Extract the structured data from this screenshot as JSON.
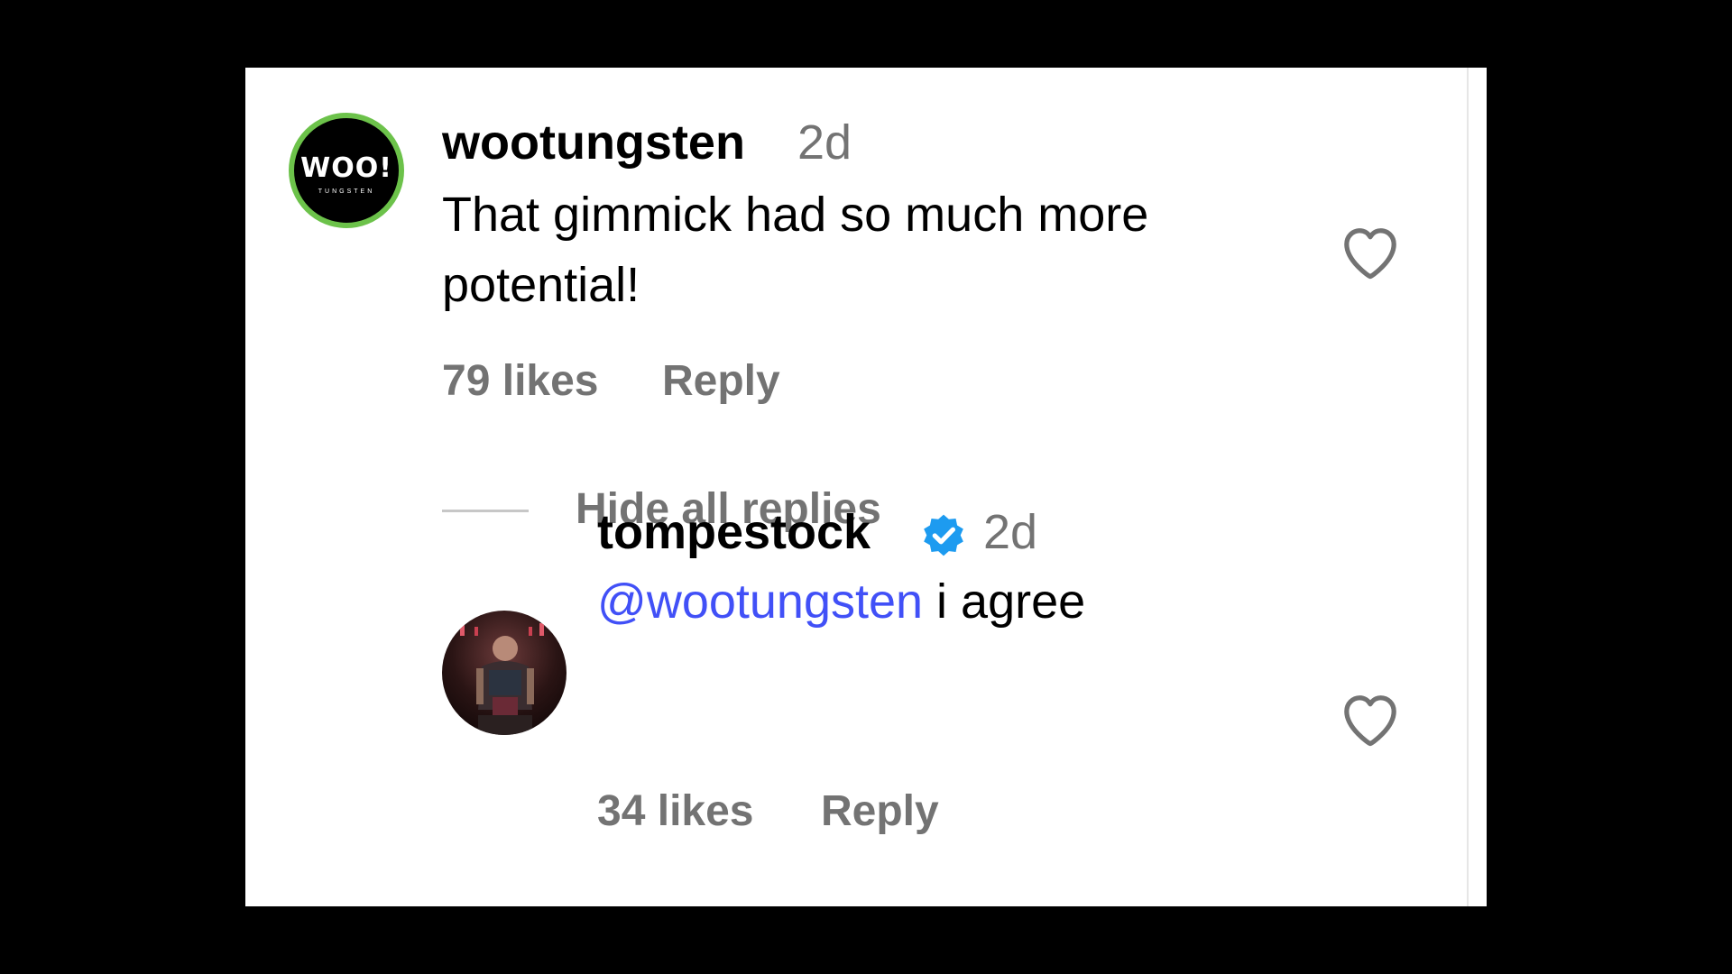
{
  "comments": [
    {
      "username": "wootungsten",
      "time": "2d",
      "text": "That gimmick had so much more potential!",
      "text_line1": "That gimmick had so much more",
      "text_line2": "potential!",
      "likes": "79 likes",
      "reply_label": "Reply",
      "avatar_logo_main": "WOO!",
      "avatar_logo_sub": "TUNGSTEN",
      "avatar_ring_color": "#6cc24a"
    },
    {
      "username": "tompestock",
      "verified": true,
      "time": "2d",
      "mention": "@wootungsten",
      "text": " i agree",
      "likes": "34 likes",
      "reply_label": "Reply"
    }
  ],
  "replies_toggle": "Hide all replies",
  "colors": {
    "mention": "#4150f7",
    "verified": "#1d9bf0",
    "secondary_text": "#737373"
  },
  "icons": [
    "heart-icon",
    "verified-badge-icon"
  ]
}
